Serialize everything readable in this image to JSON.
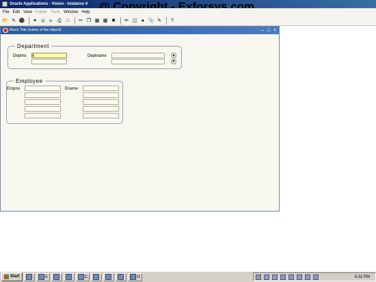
{
  "app": {
    "title": "Oracle Applications - Vision - Instance 4"
  },
  "watermark": "@ Copyright - Exforsys.com",
  "menubar": {
    "items": [
      {
        "label": "File",
        "enabled": true
      },
      {
        "label": "Edit",
        "enabled": true
      },
      {
        "label": "View",
        "enabled": true
      },
      {
        "label": "Folder",
        "enabled": false
      },
      {
        "label": "Tools",
        "enabled": false
      },
      {
        "label": "Window",
        "enabled": true
      },
      {
        "label": "Help",
        "enabled": true
      }
    ]
  },
  "toolbar": {
    "icons": [
      "open-icon",
      "new-icon",
      "find-icon",
      "navigator-icon",
      "save-icon",
      "next-step-icon",
      "print-icon",
      "close-form-icon",
      "cut-icon",
      "copy-icon",
      "paste-icon",
      "new-record-icon",
      "delete-icon",
      "edit-field-icon",
      "zoom-icon",
      "translations-icon",
      "attachments-icon",
      "folder-tools-icon",
      "help-icon"
    ]
  },
  "form": {
    "title": "Block Title (name of the object)",
    "department": {
      "frame_title": "Department",
      "deptno_label": "Deptno",
      "deptno_value": "",
      "dname_label": "Deptname",
      "dname_value": ""
    },
    "employee": {
      "frame_title": "Employee",
      "empno_label": "Empno",
      "ename_label": "Ename",
      "rows": [
        {
          "empno": "",
          "ename": ""
        },
        {
          "empno": "",
          "ename": ""
        },
        {
          "empno": "",
          "ename": ""
        },
        {
          "empno": "",
          "ename": ""
        },
        {
          "empno": "",
          "ename": ""
        }
      ]
    }
  },
  "taskbar": {
    "start_label": "Start",
    "tasks": [
      "",
      "A",
      "",
      "",
      "C",
      "",
      "",
      "",
      "O"
    ],
    "clock": "8:32 PM"
  },
  "colors": {
    "title_bar": "#0a246a",
    "form_title_bar": "#2a5a9a",
    "focus_field": "#fefca8",
    "form_background": "#f8f7ef"
  }
}
